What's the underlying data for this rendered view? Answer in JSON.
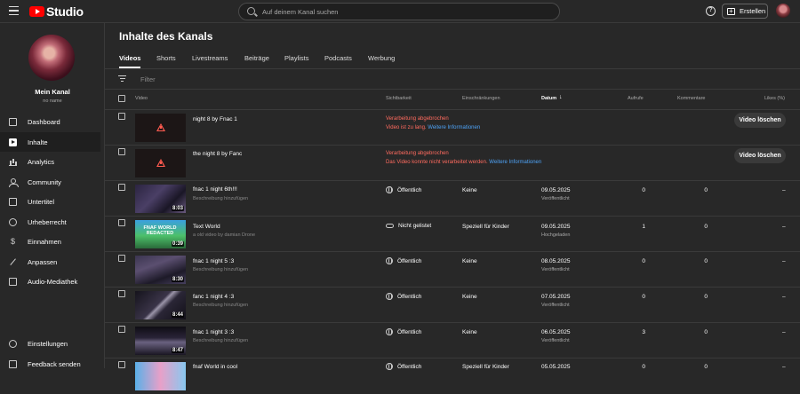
{
  "app": {
    "logo_text": "Studio"
  },
  "search": {
    "placeholder": "Auf deinem Kanal suchen"
  },
  "header": {
    "help_icon": "?",
    "create_label": "Erstellen"
  },
  "channel": {
    "name": "Mein Kanal",
    "handle": "no name"
  },
  "sidebar": {
    "items": [
      {
        "label": "Dashboard",
        "icon": "dashboard-icon"
      },
      {
        "label": "Inhalte",
        "icon": "content-icon",
        "active": true
      },
      {
        "label": "Analytics",
        "icon": "analytics-icon"
      },
      {
        "label": "Community",
        "icon": "community-icon"
      },
      {
        "label": "Untertitel",
        "icon": "subtitles-icon"
      },
      {
        "label": "Urheberrecht",
        "icon": "copyright-icon"
      },
      {
        "label": "Einnahmen",
        "icon": "earn-icon"
      },
      {
        "label": "Anpassen",
        "icon": "customize-icon"
      },
      {
        "label": "Audio-Mediathek",
        "icon": "audio-library-icon"
      }
    ],
    "bottom": [
      {
        "label": "Einstellungen",
        "icon": "gear-icon"
      },
      {
        "label": "Feedback senden",
        "icon": "feedback-icon"
      }
    ]
  },
  "main": {
    "title": "Inhalte des Kanals",
    "tabs": [
      "Videos",
      "Shorts",
      "Livestreams",
      "Beiträge",
      "Playlists",
      "Podcasts",
      "Werbung"
    ],
    "filter_placeholder": "Filter",
    "columns": {
      "video": "Video",
      "visibility": "Sichtbarkeit",
      "restrictions": "Einschränkungen",
      "date": "Datum",
      "views": "Aufrufe",
      "comments": "Kommentare",
      "likes": "Likes (%)"
    }
  },
  "rows": [
    {
      "title": "night 8 by Fnac 1",
      "status": "Verarbeitung abgebrochen",
      "error": "Video ist zu lang.",
      "link": "Weitere Informationen",
      "button": "Video löschen"
    },
    {
      "title": "the night 8 by Fanc",
      "status": "Verarbeitung abgebrochen",
      "error": "Das Video konnte nicht verarbeitet werden.",
      "link": "Weitere Informationen",
      "button": "Video löschen"
    },
    {
      "title": "fnac 1 night 6th!!!",
      "desc": "Beschreibung hinzufügen",
      "duration": "8:03",
      "visibility": "Öffentlich",
      "restriction": "Keine",
      "date": "09.05.2025",
      "date_sub": "Veröffentlicht",
      "views": "0",
      "comments": "0",
      "likes": "–"
    },
    {
      "title": "Text World",
      "desc": "a old video by damian Drone",
      "duration": "0:39",
      "visibility": "Nicht gelistet",
      "restriction": "Speziell für Kinder",
      "date": "09.05.2025",
      "date_sub": "Hochgeladen",
      "views": "1",
      "comments": "0",
      "likes": "–",
      "thumb_text": "FNAF WORLD REDACTED"
    },
    {
      "title": "fnac 1 night 5 :3",
      "desc": "Beschreibung hinzufügen",
      "duration": "8:30",
      "visibility": "Öffentlich",
      "restriction": "Keine",
      "date": "08.05.2025",
      "date_sub": "Veröffentlicht",
      "views": "0",
      "comments": "0",
      "likes": "–"
    },
    {
      "title": "fanc 1 night 4 :3",
      "desc": "Beschreibung hinzufügen",
      "duration": "8:44",
      "visibility": "Öffentlich",
      "restriction": "Keine",
      "date": "07.05.2025",
      "date_sub": "Veröffentlicht",
      "views": "0",
      "comments": "0",
      "likes": "–"
    },
    {
      "title": "fnac 1 night 3 :3",
      "desc": "Beschreibung hinzufügen",
      "duration": "8:47",
      "visibility": "Öffentlich",
      "restriction": "Keine",
      "date": "06.05.2025",
      "date_sub": "Veröffentlicht",
      "views": "3",
      "comments": "0",
      "likes": "–"
    },
    {
      "title": "fnaf World in cool",
      "visibility": "Öffentlich",
      "restriction": "Speziell für Kinder",
      "date": "05.05.2025",
      "views": "0",
      "comments": "0",
      "likes": "–"
    }
  ]
}
